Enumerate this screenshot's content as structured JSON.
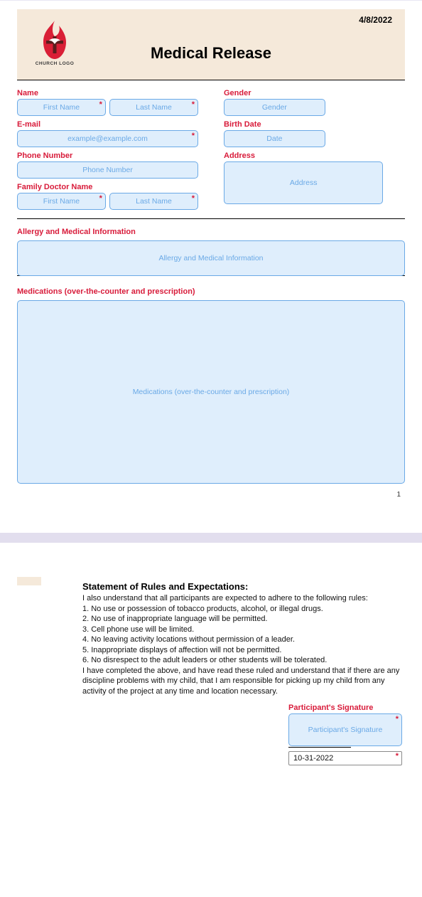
{
  "header": {
    "date": "4/8/2022",
    "logo_text": "CHURCH LOGO",
    "logo_sub": "",
    "title": "Medical Release"
  },
  "left": {
    "name_label": "Name",
    "first_ph": "First Name",
    "last_ph": "Last Name",
    "email_label": "E-mail",
    "email_ph": "example@example.com",
    "phone_label": "Phone Number",
    "phone_ph": "Phone Number",
    "doctor_label": "Family Doctor Name",
    "doc_first_ph": "First Name",
    "doc_last_ph": "Last Name"
  },
  "right": {
    "gender_label": "Gender",
    "gender_ph": "Gender",
    "birth_label": "Birth Date",
    "birth_ph": "Date",
    "address_label": "Address",
    "address_ph": "Address"
  },
  "allergy": {
    "label": "Allergy and Medical Information",
    "ph": "Allergy and Medical Information"
  },
  "meds": {
    "label": "Medications (over-the-counter and prescription)",
    "ph": "Medications (over-the-counter and prescription)"
  },
  "page1_num": "1",
  "rules": {
    "heading": "Statement of Rules and Expectations:",
    "intro": "I also understand that all participants are expected to adhere to the following rules:",
    "r1": "1. No use or possession of tobacco products, alcohol, or illegal drugs.",
    "r2": "2. No use of inappropriate language will be permitted.",
    "r3": "3. Cell phone use will be limited.",
    "r4": "4. No leaving activity locations without permission of a leader.",
    "r5": "5. Inappropriate displays of affection will not be permitted.",
    "r6": "6. No disrespect to the adult leaders or other students will be tolerated.",
    "outro": "I have completed the above, and have read these ruled and understand that if there are any discipline problems with my child, that I am responsible for picking up my child from any activity of the project at any time and location necessary."
  },
  "sig": {
    "label": "Participant's Signature",
    "ph": "Participant's Signature",
    "date_value": "10-31-2022"
  }
}
